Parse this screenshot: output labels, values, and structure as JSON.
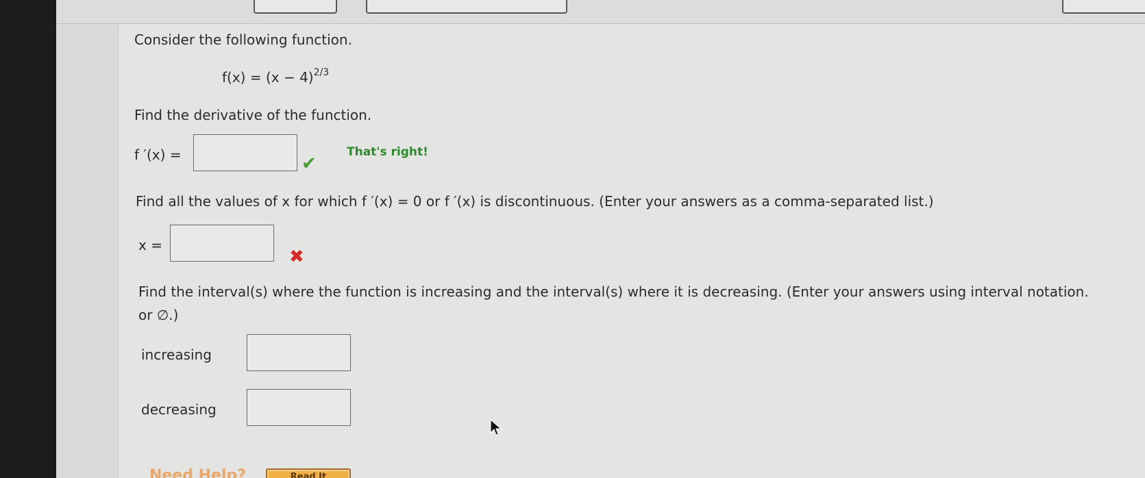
{
  "question": {
    "intro": "Consider the following function.",
    "function_lhs": "f(x) = (x − 4)",
    "function_exponent": "2/3",
    "part1_prompt": "Find the derivative of the function.",
    "part1_label": "f ′(x) =",
    "part1_answer": "",
    "part1_feedback": "That's right!",
    "part1_status_icon": "check-icon",
    "part2_prompt": "Find all the values of x for which f ′(x) = 0 or f ′(x) is discontinuous. (Enter your answers as a comma-separated list.)",
    "part2_label": "x =",
    "part2_answer": "",
    "part2_status_icon": "cross-icon",
    "part3_prompt_line1": "Find the interval(s) where the function is increasing and the interval(s) where it is decreasing. (Enter your answers using interval notation.",
    "part3_prompt_line2": "or ∅.)",
    "increasing_label": "increasing",
    "increasing_answer": "",
    "decreasing_label": "decreasing",
    "decreasing_answer": ""
  },
  "help": {
    "title": "Need Help?",
    "read_it_label": "Read It"
  },
  "colors": {
    "correct": "#2f8a2f",
    "incorrect": "#d42a2a",
    "help_title": "#e8a86a",
    "read_it_bg": "#f0b046"
  }
}
